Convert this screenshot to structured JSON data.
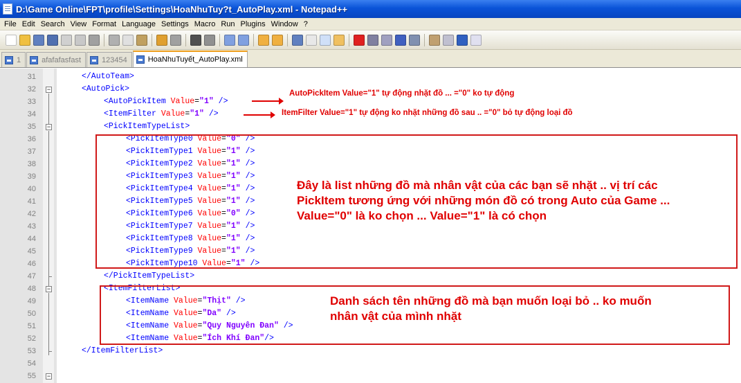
{
  "window": {
    "title": "D:\\Game Online\\FPT\\profile\\Settings\\HoaNhuTuy?t_AutoPlay.xml - Notepad++"
  },
  "menu": [
    "File",
    "Edit",
    "Search",
    "View",
    "Format",
    "Language",
    "Settings",
    "Macro",
    "Run",
    "Plugins",
    "Window",
    "?"
  ],
  "tabs": [
    {
      "label": "1",
      "active": false
    },
    {
      "label": "afafafasfast",
      "active": false
    },
    {
      "label": "123454",
      "active": false
    },
    {
      "label": "HoaNhuTuyết_AutoPlay.xml",
      "active": true
    }
  ],
  "lines": [
    {
      "n": "31",
      "indent": 1,
      "tokens": [
        [
          "tag",
          "</AutoTeam>"
        ]
      ]
    },
    {
      "n": "32",
      "indent": 1,
      "tokens": [
        [
          "tag",
          "<AutoPick>"
        ]
      ]
    },
    {
      "n": "33",
      "indent": 2,
      "tokens": [
        [
          "tag",
          "<AutoPickItem "
        ],
        [
          "attr",
          "Value"
        ],
        [
          "eq",
          "="
        ],
        [
          "val",
          "\"1\""
        ],
        [
          "tag",
          " />"
        ]
      ]
    },
    {
      "n": "34",
      "indent": 2,
      "tokens": [
        [
          "tag",
          "<ItemFilter "
        ],
        [
          "attr",
          "Value"
        ],
        [
          "eq",
          "="
        ],
        [
          "val",
          "\"1\""
        ],
        [
          "tag",
          " />"
        ]
      ]
    },
    {
      "n": "35",
      "indent": 2,
      "tokens": [
        [
          "tag",
          "<PickItemTypeList>"
        ]
      ]
    },
    {
      "n": "36",
      "indent": 3,
      "tokens": [
        [
          "tag",
          "<PickItemType0 "
        ],
        [
          "attr",
          "Value"
        ],
        [
          "eq",
          "="
        ],
        [
          "val",
          "\"0\""
        ],
        [
          "tag",
          " />"
        ]
      ]
    },
    {
      "n": "37",
      "indent": 3,
      "tokens": [
        [
          "tag",
          "<PickItemType1 "
        ],
        [
          "attr",
          "Value"
        ],
        [
          "eq",
          "="
        ],
        [
          "val",
          "\"1\""
        ],
        [
          "tag",
          " />"
        ]
      ]
    },
    {
      "n": "38",
      "indent": 3,
      "tokens": [
        [
          "tag",
          "<PickItemType2 "
        ],
        [
          "attr",
          "Value"
        ],
        [
          "eq",
          "="
        ],
        [
          "val",
          "\"1\""
        ],
        [
          "tag",
          " />"
        ]
      ]
    },
    {
      "n": "39",
      "indent": 3,
      "tokens": [
        [
          "tag",
          "<PickItemType3 "
        ],
        [
          "attr",
          "Value"
        ],
        [
          "eq",
          "="
        ],
        [
          "val",
          "\"1\""
        ],
        [
          "tag",
          " />"
        ]
      ]
    },
    {
      "n": "40",
      "indent": 3,
      "tokens": [
        [
          "tag",
          "<PickItemType4 "
        ],
        [
          "attr",
          "Value"
        ],
        [
          "eq",
          "="
        ],
        [
          "val",
          "\"1\""
        ],
        [
          "tag",
          " />"
        ]
      ]
    },
    {
      "n": "41",
      "indent": 3,
      "tokens": [
        [
          "tag",
          "<PickItemType5 "
        ],
        [
          "attr",
          "Value"
        ],
        [
          "eq",
          "="
        ],
        [
          "val",
          "\"1\""
        ],
        [
          "tag",
          " />"
        ]
      ]
    },
    {
      "n": "42",
      "indent": 3,
      "tokens": [
        [
          "tag",
          "<PickItemType6 "
        ],
        [
          "attr",
          "Value"
        ],
        [
          "eq",
          "="
        ],
        [
          "val",
          "\"0\""
        ],
        [
          "tag",
          " />"
        ]
      ]
    },
    {
      "n": "43",
      "indent": 3,
      "tokens": [
        [
          "tag",
          "<PickItemType7 "
        ],
        [
          "attr",
          "Value"
        ],
        [
          "eq",
          "="
        ],
        [
          "val",
          "\"1\""
        ],
        [
          "tag",
          " />"
        ]
      ]
    },
    {
      "n": "44",
      "indent": 3,
      "tokens": [
        [
          "tag",
          "<PickItemType8 "
        ],
        [
          "attr",
          "Value"
        ],
        [
          "eq",
          "="
        ],
        [
          "val",
          "\"1\""
        ],
        [
          "tag",
          " />"
        ]
      ]
    },
    {
      "n": "45",
      "indent": 3,
      "tokens": [
        [
          "tag",
          "<PickItemType9 "
        ],
        [
          "attr",
          "Value"
        ],
        [
          "eq",
          "="
        ],
        [
          "val",
          "\"1\""
        ],
        [
          "tag",
          " />"
        ]
      ]
    },
    {
      "n": "46",
      "indent": 3,
      "tokens": [
        [
          "tag",
          "<PickItemType10 "
        ],
        [
          "attr",
          "Value"
        ],
        [
          "eq",
          "="
        ],
        [
          "val",
          "\"1\""
        ],
        [
          "tag",
          " />"
        ]
      ]
    },
    {
      "n": "47",
      "indent": 2,
      "tokens": [
        [
          "tag",
          "</PickItemTypeList>"
        ]
      ]
    },
    {
      "n": "48",
      "indent": 2,
      "tokens": [
        [
          "tag",
          "<ItemFilterList>"
        ]
      ]
    },
    {
      "n": "49",
      "indent": 3,
      "tokens": [
        [
          "tag",
          "<ItemName "
        ],
        [
          "attr",
          "Value"
        ],
        [
          "eq",
          "="
        ],
        [
          "val",
          "\"Thịt\""
        ],
        [
          "tag",
          " />"
        ]
      ]
    },
    {
      "n": "50",
      "indent": 3,
      "tokens": [
        [
          "tag",
          "<ItemName "
        ],
        [
          "attr",
          "Value"
        ],
        [
          "eq",
          "="
        ],
        [
          "val",
          "\"Da\""
        ],
        [
          "tag",
          " />"
        ]
      ]
    },
    {
      "n": "51",
      "indent": 3,
      "tokens": [
        [
          "tag",
          "<ItemName "
        ],
        [
          "attr",
          "Value"
        ],
        [
          "eq",
          "="
        ],
        [
          "val",
          "\"Quy Nguyên Đan\""
        ],
        [
          "tag",
          " />"
        ]
      ]
    },
    {
      "n": "52",
      "indent": 3,
      "tokens": [
        [
          "tag",
          "<ItemName "
        ],
        [
          "attr",
          "Value"
        ],
        [
          "eq",
          "="
        ],
        [
          "val",
          "\"Ích Khí Đan\""
        ],
        [
          "tag",
          "/>"
        ]
      ]
    },
    {
      "n": "53",
      "indent": 1,
      "tokens": [
        [
          "tag",
          "</ItemFilterList>"
        ]
      ]
    },
    {
      "n": "54",
      "indent": 0,
      "tokens": []
    },
    {
      "n": "55",
      "indent": 0,
      "tokens": []
    }
  ],
  "annotations": {
    "autopick": "AutoPickItem Value=\"1\" tự động nhặt đồ ... =\"0\" ko tự động",
    "itemfilter": "ItemFilter Value=\"1\" tự động ko nhặt những đồ sau .. =\"0\" bỏ tự động loại đồ",
    "list_line1": "Đây là list những đồ mà nhân vật của các bạn sẽ nhặt .. vị trí các",
    "list_line2": "PickItem tương ứng với những món đồ có trong Auto của Game ...",
    "list_line3": "Value=\"0\" là ko chọn ... Value=\"1\" là có chọn",
    "filter_line1": "Danh sách tên những đồ mà bạn muốn loại bỏ .. ko muốn",
    "filter_line2": "nhân vật của mình nhặt"
  }
}
